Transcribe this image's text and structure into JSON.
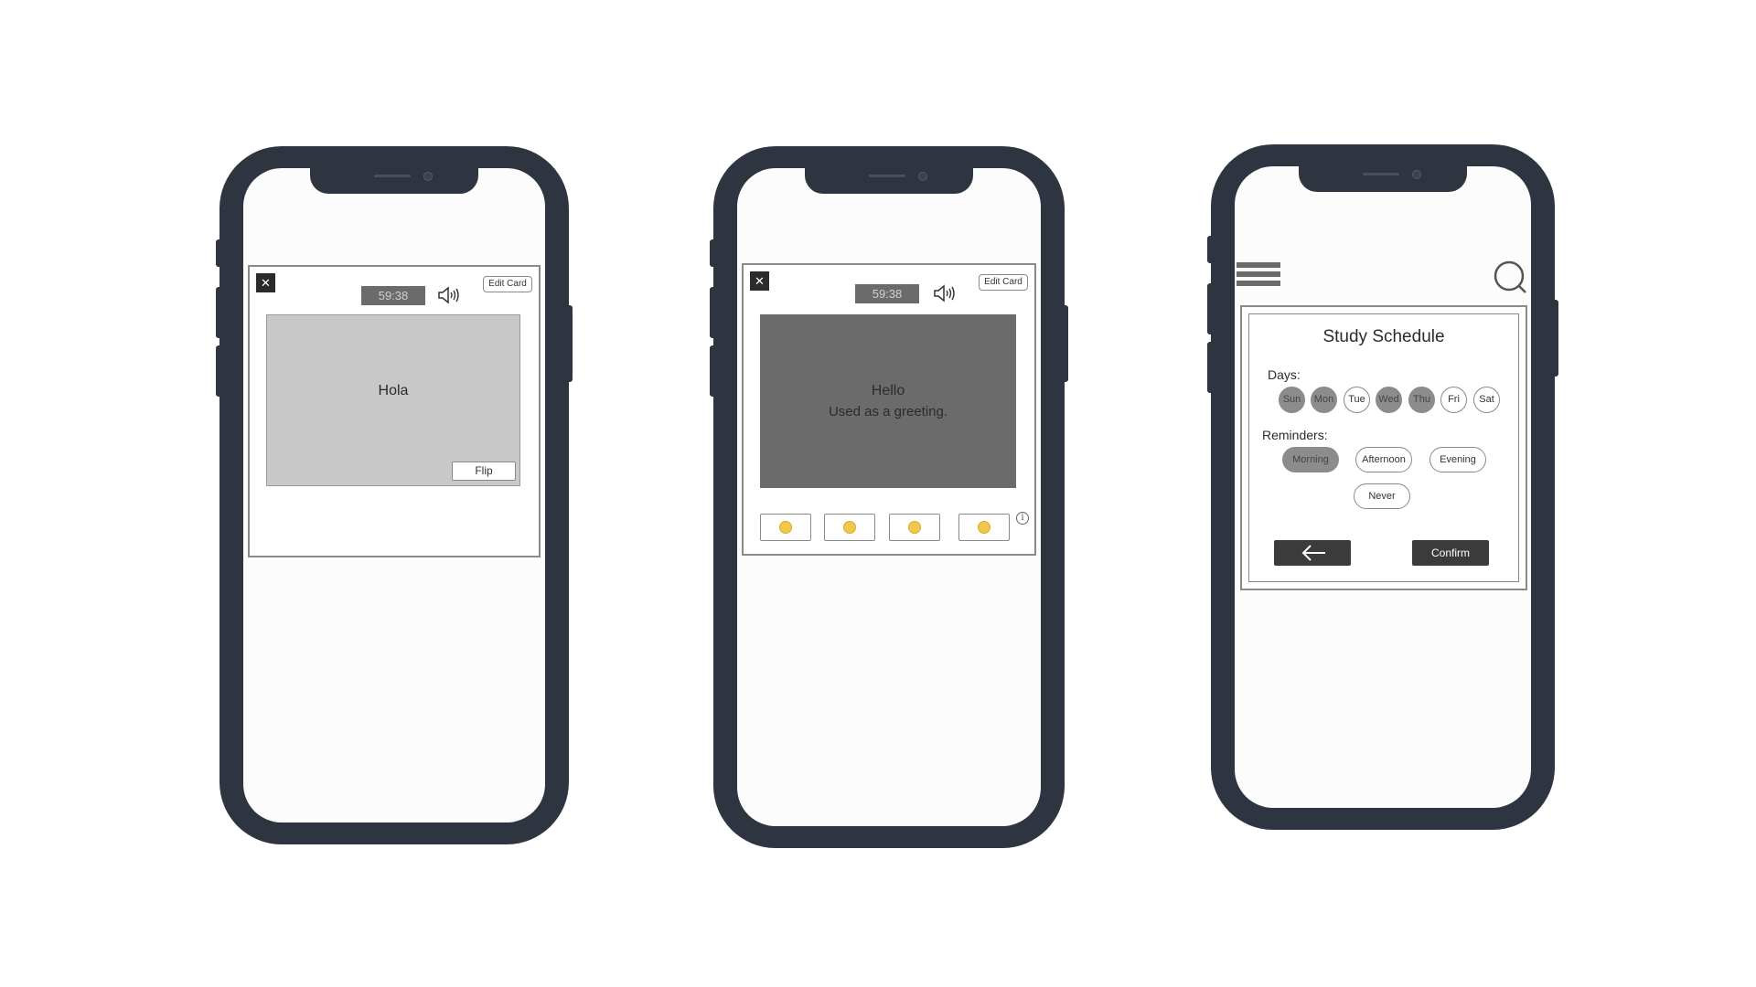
{
  "phone1": {
    "close_label": "✕",
    "timer": "59:38",
    "edit_label": "Edit Card",
    "card_word": "Hola",
    "flip_label": "Flip"
  },
  "phone2": {
    "close_label": "✕",
    "timer": "59:38",
    "edit_label": "Edit Card",
    "card_word": "Hello",
    "card_definition": "Used as a greeting.",
    "ratings": [
      "frown-emoji-icon",
      "neutral-emoji-icon",
      "smile-emoji-icon",
      "grin-emoji-icon"
    ],
    "info_label": "i"
  },
  "phone3": {
    "title": "Study Schedule",
    "days_label": "Days:",
    "days": [
      {
        "label": "Sun",
        "selected": true
      },
      {
        "label": "Mon",
        "selected": true
      },
      {
        "label": "Tue",
        "selected": false
      },
      {
        "label": "Wed",
        "selected": true
      },
      {
        "label": "Thu",
        "selected": true
      },
      {
        "label": "Fri",
        "selected": false
      },
      {
        "label": "Sat",
        "selected": false
      }
    ],
    "reminders_label": "Reminders:",
    "reminders": [
      {
        "label": "Morning",
        "selected": true
      },
      {
        "label": "Afternoon",
        "selected": false
      },
      {
        "label": "Evening",
        "selected": false
      },
      {
        "label": "Never",
        "selected": false
      }
    ],
    "confirm_label": "Confirm"
  },
  "colors": {
    "phone_frame": "#2f3540",
    "card_front": "#c8c8c8",
    "card_back": "#6b6b6b",
    "chip_selected": "#8c8c8c",
    "button_dark": "#3b3b3b"
  }
}
